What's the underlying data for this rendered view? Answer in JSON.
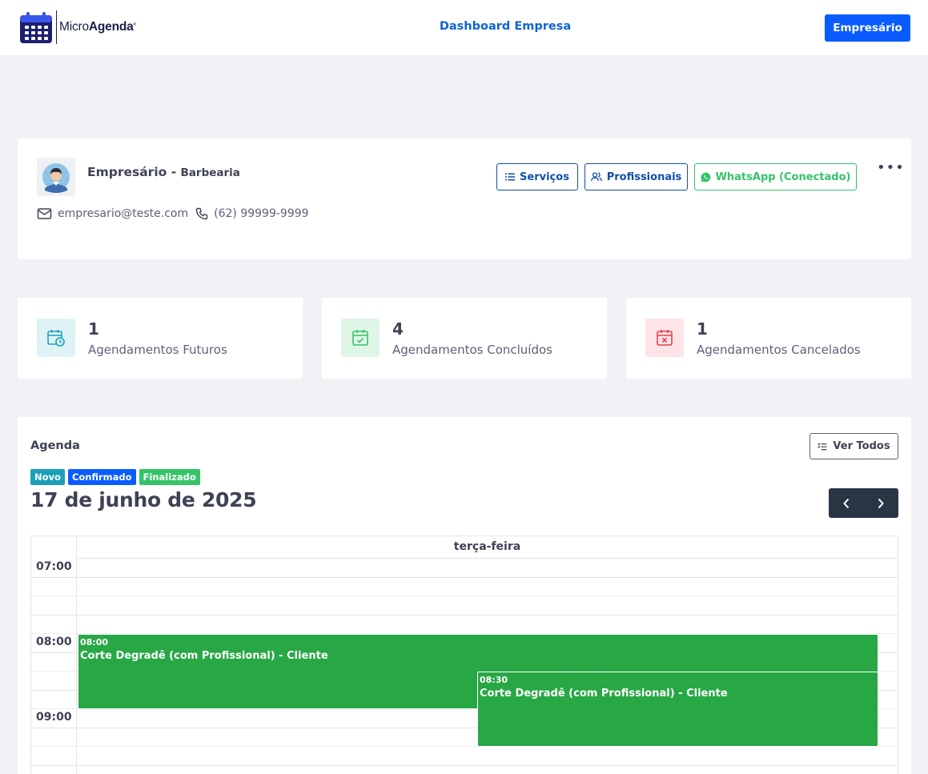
{
  "header": {
    "logo_text_light": "Micro",
    "logo_text_bold": "Agenda",
    "logo_mark": "®",
    "title": "Dashboard Empresa",
    "user_button": "Empresário"
  },
  "profile": {
    "name": "Empresário",
    "separator": " - ",
    "business": "Barbearia",
    "email": "empresario@teste.com",
    "phone": "(62) 99999-9999",
    "buttons": {
      "services": "Serviços",
      "professionals": "Profissionais",
      "whatsapp": "WhatsApp (Conectado)"
    },
    "more_icon": "more-horizontal-icon"
  },
  "stats": [
    {
      "value": "1",
      "label": "Agendamentos Futuros",
      "icon": "calendar-clock-icon",
      "color": "#1b9fba"
    },
    {
      "value": "4",
      "label": "Agendamentos Concluídos",
      "icon": "calendar-check-icon",
      "color": "#34c46a"
    },
    {
      "value": "1",
      "label": "Agendamentos Cancelados",
      "icon": "calendar-x-icon",
      "color": "#e5414f"
    }
  ],
  "agenda": {
    "title": "Agenda",
    "view_all": "Ver Todos",
    "legend": [
      {
        "label": "Novo",
        "color": "#1b9fba"
      },
      {
        "label": "Confirmado",
        "color": "#0a5cff"
      },
      {
        "label": "Finalizado",
        "color": "#34c46a"
      }
    ],
    "date": "17 de junho de 2025",
    "day_header": "terça-feira",
    "times": [
      "07:00",
      "08:00",
      "09:00"
    ],
    "events": [
      {
        "time": "08:00",
        "title": "Corte Degradê (com Profissional) - Cliente",
        "color": "#28a745"
      },
      {
        "time": "08:30",
        "title": "Corte Degradê (com Profissional) - Cliente",
        "color": "#28a745"
      }
    ]
  },
  "colors": {
    "primary": "#0a5cff",
    "header_title": "#0f63d6",
    "outline_blue": "#0f4fa8",
    "whatsapp_green": "#34c46a",
    "event_green": "#28a745",
    "nav_dark": "#2a3544"
  }
}
